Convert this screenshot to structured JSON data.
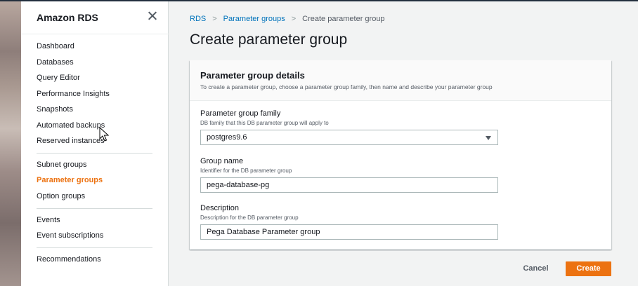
{
  "sidebar": {
    "title": "Amazon RDS",
    "groups": [
      [
        "Dashboard",
        "Databases",
        "Query Editor",
        "Performance Insights",
        "Snapshots",
        "Automated backups",
        "Reserved instances"
      ],
      [
        "Subnet groups",
        "Parameter groups",
        "Option groups"
      ],
      [
        "Events",
        "Event subscriptions"
      ],
      [
        "Recommendations"
      ]
    ],
    "active_item": "Parameter groups"
  },
  "breadcrumb": {
    "items": [
      "RDS",
      "Parameter groups"
    ],
    "current": "Create parameter group"
  },
  "page_title": "Create parameter group",
  "panel": {
    "title": "Parameter group details",
    "description": "To create a parameter group, choose a parameter group family, then name and describe your parameter group",
    "family": {
      "label": "Parameter group family",
      "hint": "DB family that this DB parameter group will apply to",
      "value": "postgres9.6"
    },
    "group_name": {
      "label": "Group name",
      "hint": "Identifier for the DB parameter group",
      "value": "pega-database-pg"
    },
    "description_field": {
      "label": "Description",
      "hint": "Description for the DB parameter group",
      "value": "Pega Database Parameter group"
    }
  },
  "actions": {
    "cancel": "Cancel",
    "create": "Create"
  },
  "colors": {
    "accent": "#ec7211",
    "link": "#0073bb"
  }
}
